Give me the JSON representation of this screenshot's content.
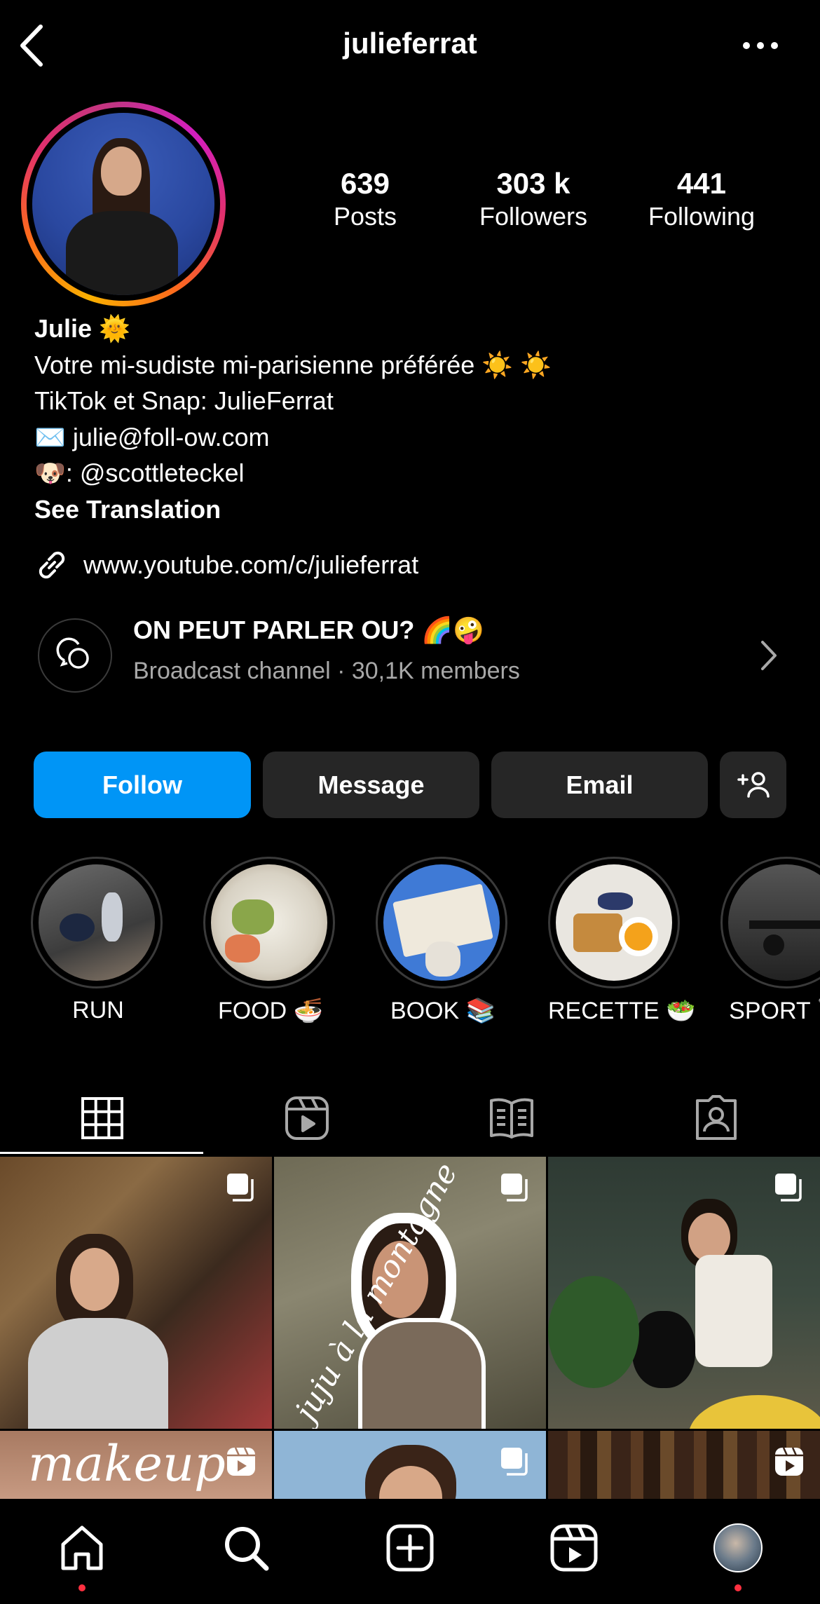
{
  "header": {
    "username": "julieferrat",
    "back_icon": "chevron-left-icon",
    "more_icon": "more-horizontal-icon"
  },
  "stats": {
    "posts": {
      "value": "639",
      "label": "Posts"
    },
    "followers": {
      "value": "303 k",
      "label": "Followers"
    },
    "following": {
      "value": "441",
      "label": "Following"
    }
  },
  "bio": {
    "name": "Julie 🌞",
    "line1": "Votre mi-sudiste mi-parisienne préférée ☀️ ☀️",
    "line2": "TikTok et Snap: JulieFerrat",
    "line3": "✉️ julie@foll-ow.com",
    "line4": "🐶: @scottleteckel",
    "see_translation": "See Translation",
    "link": "www.youtube.com/c/julieferrat"
  },
  "broadcast": {
    "title": "ON PEUT PARLER OU? 🌈🤪",
    "subtitle": "Broadcast channel · 30,1K members"
  },
  "buttons": {
    "follow": "Follow",
    "message": "Message",
    "email": "Email"
  },
  "highlights": [
    {
      "label": "RUN"
    },
    {
      "label": "FOOD 🍜"
    },
    {
      "label": "BOOK 📚"
    },
    {
      "label": "RECETTE 🥗"
    },
    {
      "label": "SPORT 🏋"
    }
  ],
  "tabs": [
    "grid-icon",
    "reels-icon",
    "guides-icon",
    "tagged-icon"
  ],
  "grid_overlays": {
    "post2_text": "juju à la montagne",
    "post4_text": "makeup"
  },
  "colors": {
    "accent": "#0095f6",
    "button": "#262626",
    "muted": "#a8a8a8",
    "notif": "#ff3040"
  }
}
